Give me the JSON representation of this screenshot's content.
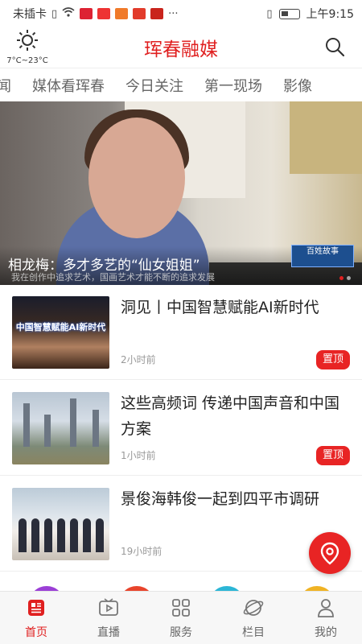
{
  "status_bar": {
    "carrier": "未插卡",
    "time": "上午9:15"
  },
  "header": {
    "weather_temp": "7°C~23°C",
    "brand_title": "珲春融媒",
    "brand_color": "#e02020"
  },
  "tabs": [
    "新闻",
    "媒体看珲春",
    "今日关注",
    "第一现场",
    "影像"
  ],
  "hero": {
    "caption": "相龙梅：多才多艺的“仙女姐姐”",
    "subtitle": "我在创作中追求艺术，国画艺术才能不断的追求发展",
    "logo_text": "百姓故事"
  },
  "news": [
    {
      "title": "洞见丨中国智慧赋能AI新时代",
      "time": "2小时前",
      "badge": "置顶",
      "thumb_text": "中国智慧赋能AI新时代"
    },
    {
      "title": "这些高频词 传递中国声音和中国方案",
      "time": "1小时前",
      "badge": "置顶"
    },
    {
      "title": "景俊海韩俊一起到四平市调研",
      "time": "19小时前"
    }
  ],
  "bottom_nav": [
    {
      "label": "首页",
      "icon": "news-icon",
      "active": true
    },
    {
      "label": "直播",
      "icon": "live-video-icon",
      "active": false
    },
    {
      "label": "服务",
      "icon": "grid-icon",
      "active": false
    },
    {
      "label": "栏目",
      "icon": "planet-icon",
      "active": false
    },
    {
      "label": "我的",
      "icon": "user-icon",
      "active": false
    }
  ],
  "colors": {
    "accent": "#e02020",
    "badge": "#e82424"
  }
}
